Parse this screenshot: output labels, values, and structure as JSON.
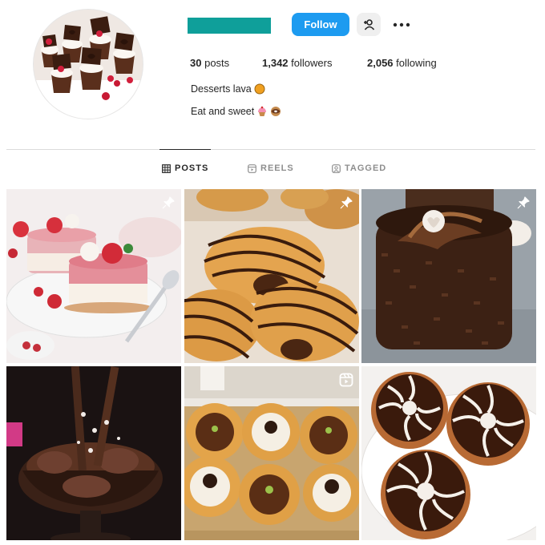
{
  "profile": {
    "follow_label": "Follow",
    "username_redacted": true,
    "stats": {
      "posts_count": "30",
      "posts_label": "posts",
      "followers_count": "1,342",
      "followers_label": "followers",
      "following_count": "2,056",
      "following_label": "following"
    },
    "bio": {
      "name": "Desserts lava",
      "name_emoji": "🟠",
      "description": "Eat and sweet",
      "description_emojis": [
        "🧁",
        "🍩"
      ]
    }
  },
  "tabs": [
    {
      "label": "POSTS",
      "icon": "grid-icon",
      "active": true
    },
    {
      "label": "REELS",
      "icon": "reels-icon",
      "active": false
    },
    {
      "label": "TAGGED",
      "icon": "tagged-icon",
      "active": false
    }
  ],
  "posts": [
    {
      "subject": "pink mousse cakes with raspberries",
      "badge": "pin-icon"
    },
    {
      "subject": "chocolate drizzled croissants",
      "badge": "pin-icon"
    },
    {
      "subject": "chocolate cake with chocolate curls",
      "badge": "pin-icon"
    },
    {
      "subject": "chocolate dessert in a glass",
      "badge": ""
    },
    {
      "subject": "chocolate and cream tartlets",
      "badge": "reel-icon"
    },
    {
      "subject": "marbled chocolate donuts",
      "badge": ""
    }
  ],
  "colors": {
    "follow_button": "#1d9bf0",
    "username_placeholder": "#0f9f9a",
    "text": "#262626",
    "muted_text": "#8e8e8e",
    "divider": "#dbdbdb"
  }
}
